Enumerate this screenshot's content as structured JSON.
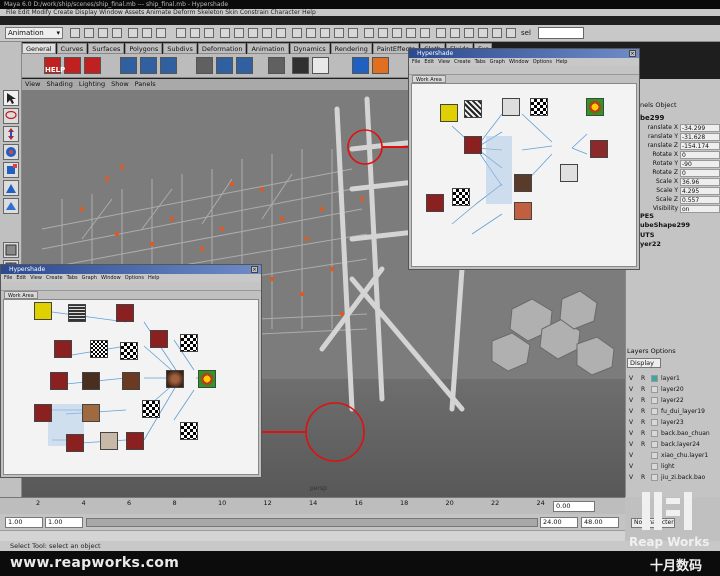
{
  "window": {
    "title_text": "Maya 6.0 D:/work/ship/scenes/ship_final.mb --- ship_final.mb - Hypershade",
    "menu_text": "File  Edit  Modify  Create  Display  Window  Assets  Animate  Deform  Skeleton  Skin  Constrain  Character  Help"
  },
  "status": {
    "mode": "Animation",
    "sel_label": "sel"
  },
  "shelf_tabs": [
    "General",
    "Curves",
    "Surfaces",
    "Polygons",
    "Subdivs",
    "Deformation",
    "Animation",
    "Dynamics",
    "Rendering",
    "PaintEffects",
    "Cloth",
    "Fluids",
    "Fur"
  ],
  "shelf_active": 0,
  "viewport": {
    "menu": [
      "View",
      "Shading",
      "Lighting",
      "Show",
      "Panels"
    ],
    "camera_label": "persp"
  },
  "channel_box": {
    "header": "nels  Object",
    "object": "be299",
    "rows": [
      {
        "label": "ranslate X",
        "value": "-34.299"
      },
      {
        "label": "ranslate Y",
        "value": "-31.628"
      },
      {
        "label": "ranslate Z",
        "value": "-154.174"
      },
      {
        "label": "Rotate X",
        "value": "0"
      },
      {
        "label": "Rotate Y",
        "value": "-90"
      },
      {
        "label": "Rotate Z",
        "value": "0"
      },
      {
        "label": "Scale X",
        "value": "36.96"
      },
      {
        "label": "Scale Y",
        "value": "4.295"
      },
      {
        "label": "Scale Z",
        "value": "0.557"
      },
      {
        "label": "Visibility",
        "value": "on"
      }
    ],
    "shapes_label": "PES",
    "shape_name": "ubeShape299",
    "inputs_label": "UTS",
    "input_name": "yer22"
  },
  "layers": {
    "header": "Layers  Options",
    "display": "Display",
    "items": [
      {
        "v": "V",
        "r": "R",
        "name": "layer1"
      },
      {
        "v": "V",
        "r": "R",
        "name": "layer20"
      },
      {
        "v": "V",
        "r": "R",
        "name": "layer22"
      },
      {
        "v": "V",
        "r": "R",
        "name": "fu_dui_layer19"
      },
      {
        "v": "V",
        "r": "R",
        "name": "layer23"
      },
      {
        "v": "V",
        "r": "R",
        "name": "back.bao_chuan"
      },
      {
        "v": "V",
        "r": "R",
        "name": "back.layer24"
      },
      {
        "v": "V",
        "r": "",
        "name": "xiao_chu.layer1"
      },
      {
        "v": "V",
        "r": "",
        "name": "light"
      },
      {
        "v": "V",
        "r": "R",
        "name": "jiu_zi.back.bao"
      }
    ]
  },
  "hypershade_small": {
    "title": "Hypershade",
    "menu": [
      "File",
      "Edit",
      "View",
      "Create",
      "Tabs",
      "Graph",
      "Window",
      "Options",
      "Help"
    ],
    "tab": "Work Area"
  },
  "hypershade_large": {
    "title": "Hypershade",
    "menu": [
      "File",
      "Edit",
      "View",
      "Create",
      "Tabs",
      "Graph",
      "Window",
      "Options",
      "Help"
    ],
    "tab": "Work Area"
  },
  "shelf_help_label": "HELP",
  "timeline": {
    "ticks": [
      "2",
      "4",
      "6",
      "8",
      "10",
      "12",
      "14",
      "16",
      "18",
      "20",
      "22",
      "24"
    ],
    "current_frame": "0.00",
    "start": "1.00",
    "start2": "1.00",
    "end": "24.00",
    "end2": "48.00",
    "character": "No Character"
  },
  "help_line": "Select Tool: select an object",
  "footer": {
    "url": "www.reapworks.com",
    "brand": "Reap Works",
    "brand_cn": "十月数码"
  },
  "colors": {
    "accent_red": "#e01010",
    "hypershade_titlebar": "#2b4a8f",
    "layer_teal": "#3aa8a0"
  }
}
